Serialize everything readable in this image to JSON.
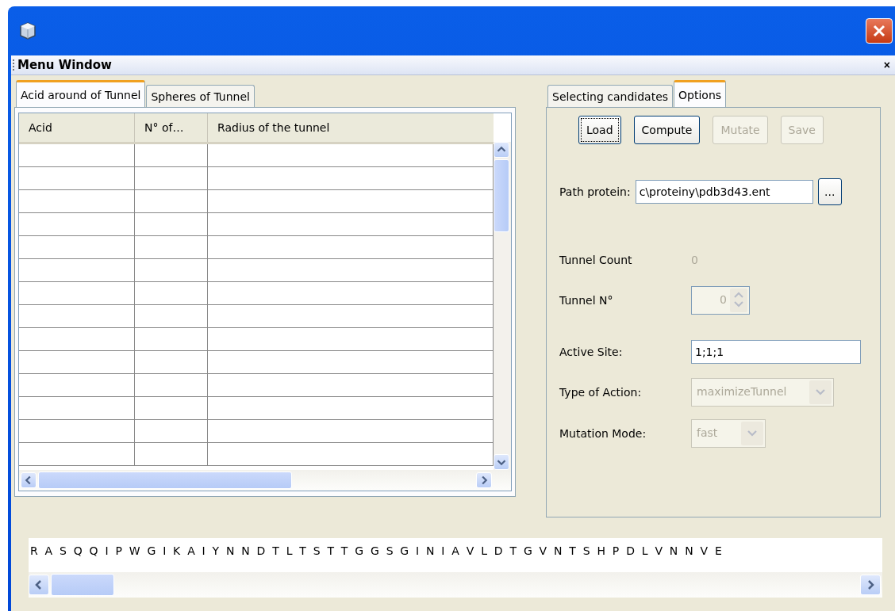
{
  "menu_bar": {
    "title": "Menu Window",
    "close": "×"
  },
  "left_tabs": [
    {
      "label": "Acid around of Tunnel",
      "selected": true
    },
    {
      "label": "Spheres of Tunnel",
      "selected": false
    }
  ],
  "table": {
    "columns": [
      "Acid",
      "N° of…",
      "Radius of the tunnel"
    ]
  },
  "right_tabs": [
    {
      "label": "Selecting candidates",
      "selected": false
    },
    {
      "label": "Options",
      "selected": true
    }
  ],
  "buttons": [
    {
      "label": "Load",
      "disabled": false,
      "focused": true
    },
    {
      "label": "Compute",
      "disabled": false,
      "focused": false
    },
    {
      "label": "Mutate",
      "disabled": true,
      "focused": false
    },
    {
      "label": "Save",
      "disabled": true,
      "focused": false
    }
  ],
  "path": {
    "label": "Path protein:",
    "value": "c\\proteiny\\pdb3d43.ent",
    "browse": "..."
  },
  "fields": [
    {
      "kind": "readout",
      "label": "Tunnel Count",
      "value": "0",
      "disabled": true
    },
    {
      "kind": "spinner",
      "label": "Tunnel N°",
      "value": "0",
      "disabled": true
    },
    {
      "kind": "text",
      "label": "Active Site:",
      "value": "1;1;1",
      "disabled": false
    },
    {
      "kind": "combo",
      "label": "Type of Action:",
      "value": "maximizeTunnel",
      "disabled": true
    },
    {
      "kind": "combo",
      "label": "Mutation Mode:",
      "value": "fast",
      "disabled": true
    }
  ],
  "sequence": "R A S Q Q I P W G I K A I Y N N D T L T S T T G G S G I N I A V L D T G V N T S H P D L V N N V E"
}
